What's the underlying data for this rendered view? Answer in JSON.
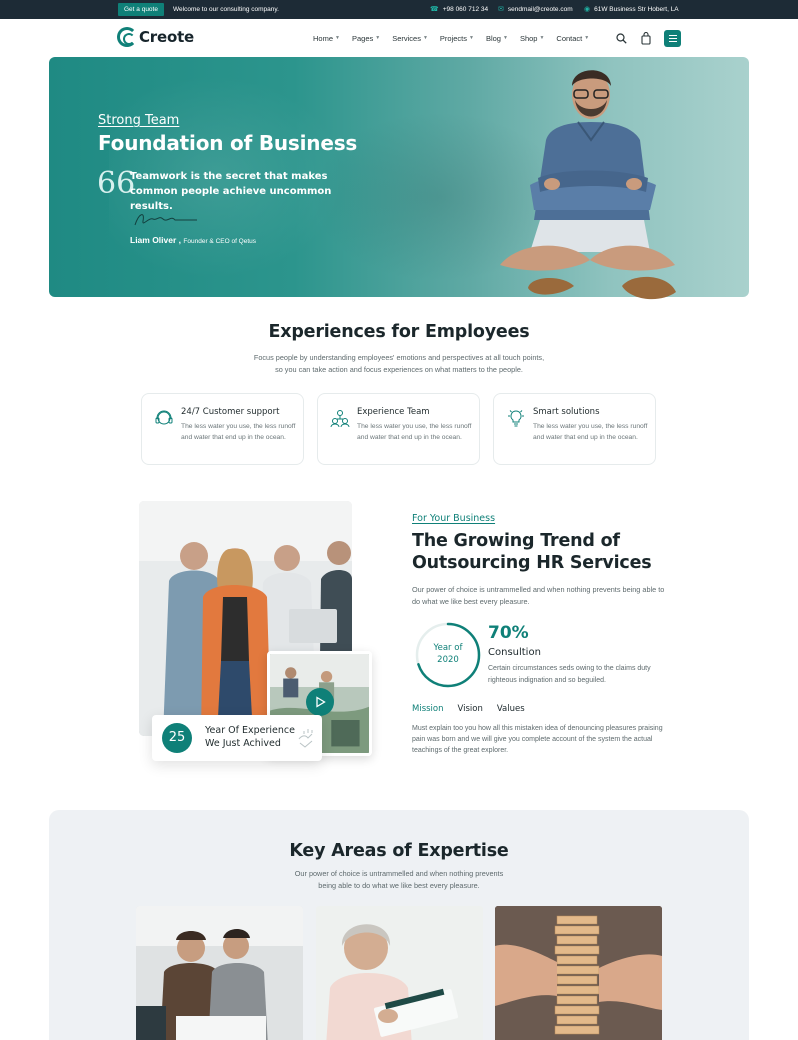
{
  "topbar": {
    "quote_button": "Get a quote",
    "welcome": "Welcome to our consulting company.",
    "phone": "+98 060 712 34",
    "email": "sendmail@creote.com",
    "address": "61W Business Str Hobert, LA"
  },
  "header": {
    "logo_text": "Creote",
    "nav": [
      "Home",
      "Pages",
      "Services",
      "Projects",
      "Blog",
      "Shop",
      "Contact"
    ]
  },
  "hero": {
    "subtitle": "Strong Team",
    "title": "Foundation of Business",
    "quote_mark": "66",
    "quote": "Teamwork is the secret that makes common people achieve uncommon results.",
    "author_name": "Liam Oliver ,",
    "author_role": "Founder & CEO of Qetus"
  },
  "experiences": {
    "title": "Experiences for Employees",
    "desc_line1": "Focus people by understanding employees' emotions and perspectives at all touch points,",
    "desc_line2": "so you can take action and focus experiences on what matters to the people.",
    "cards": [
      {
        "title": "24/7 Customer support",
        "desc": "The less water you use, the less runoff and water that end up in the ocean.",
        "icon": "headset-icon"
      },
      {
        "title": "Experience Team",
        "desc": "The less water you use, the less runoff and water that end up in the ocean.",
        "icon": "team-icon"
      },
      {
        "title": "Smart solutions",
        "desc": "The less water you use, the less runoff and water that end up in the ocean.",
        "icon": "lightbulb-icon"
      }
    ]
  },
  "about": {
    "experience_years": "25",
    "experience_text": "Year Of Experience We Just Achived",
    "kicker": "For Your Business",
    "title": "The Growing Trend of Outsourcing HR Services",
    "desc": "Our power of choice is untrammelled and when nothing prevents being able to do what we like best every pleasure.",
    "year_label": "Year of",
    "year_value": "2020",
    "progress": 0.7,
    "percent": "70%",
    "consult_title": "Consultion",
    "consult_desc": "Certain circumstances seds owing to the claims duty righteous indignation and so beguiled.",
    "tabs": [
      "Mission",
      "Vision",
      "Values"
    ],
    "tab_desc": "Must explain too you how all this mistaken idea of denouncing pleasures praising pain was born and we will give you complete account of the system the actual teachings of the great explorer."
  },
  "expertise": {
    "title": "Key Areas of Expertise",
    "desc_line1": "Our power of choice is untrammelled and when nothing prevents",
    "desc_line2": "being able to do what we like best every pleasure."
  },
  "colors": {
    "accent": "#0f8078",
    "topbar_bg": "#1d2b36",
    "expertise_bg": "#eef1f4"
  }
}
